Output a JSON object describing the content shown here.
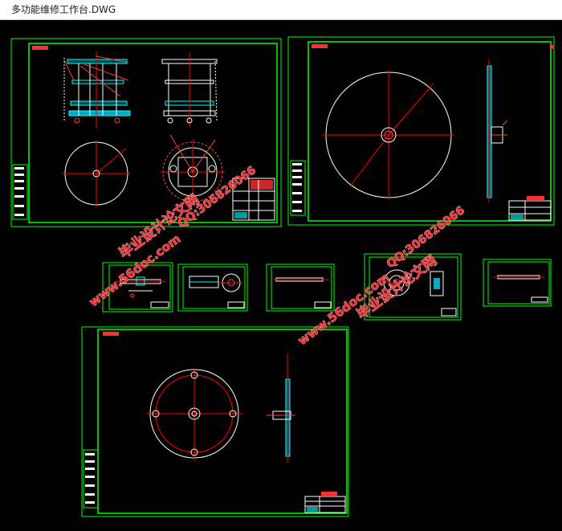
{
  "window": {
    "title": "多功能维修工作台.DWG"
  },
  "watermarks": [
    "www.56doc.com",
    "QQ:306826066",
    "毕业设计论文网"
  ],
  "colors": {
    "background": "#000000",
    "frame": "#00ff00",
    "entity_white": "#ffffff",
    "entity_red": "#ff0000",
    "entity_cyan": "#00ffff",
    "watermark_red": "#ff2020"
  }
}
